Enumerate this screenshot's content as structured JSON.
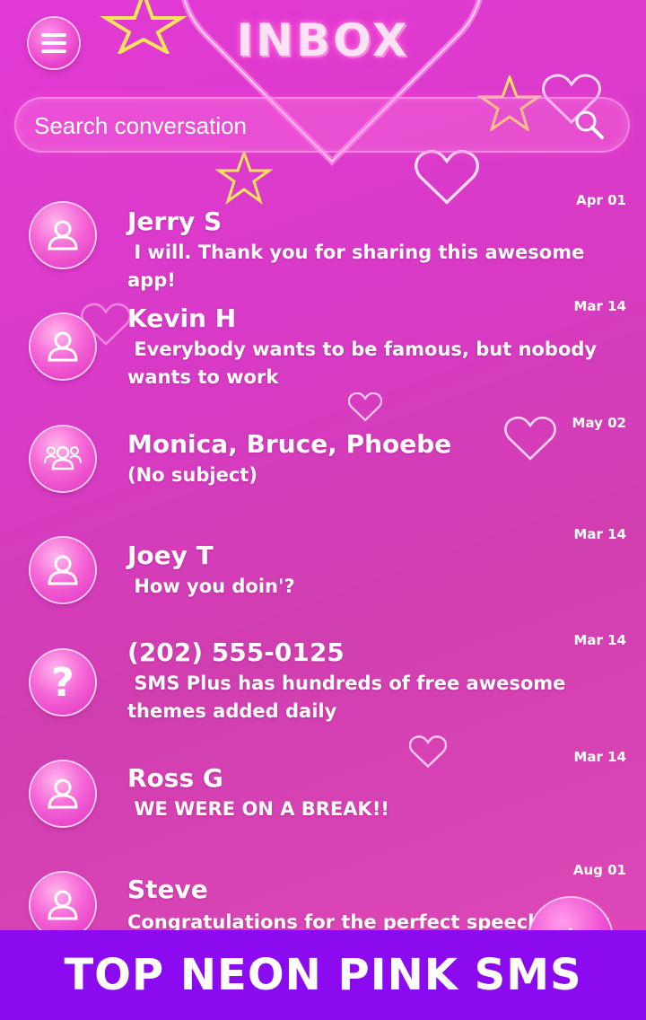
{
  "header": {
    "title": "INBOX",
    "menu_icon": "hamburger-icon"
  },
  "search": {
    "placeholder": "Search conversation",
    "icon": "search-icon"
  },
  "conversations": [
    {
      "name": "Jerry S",
      "snippet": " I will. Thank you for sharing this awesome app!",
      "date": "Apr 01",
      "avatar": "person-icon"
    },
    {
      "name": "Kevin H",
      "snippet": " Everybody wants to be famous, but nobody wants to work",
      "date": "Mar 14",
      "avatar": "person-icon"
    },
    {
      "name": "Monica, Bruce, Phoebe",
      "snippet": "(No subject)",
      "date": "May 02",
      "avatar": "group-icon"
    },
    {
      "name": "Joey T",
      "snippet": " How you doin'?",
      "date": "Mar 14",
      "avatar": "person-icon"
    },
    {
      "name": "(202) 555-0125",
      "snippet": " SMS Plus has hundreds of free awesome themes added daily",
      "date": "Mar 14",
      "avatar": "question-icon"
    },
    {
      "name": "Ross G",
      "snippet": " WE WERE ON A BREAK!!",
      "date": "Mar 14",
      "avatar": "person-icon"
    },
    {
      "name": "Steve",
      "snippet": "Congratulations for the perfect speech held t",
      "date": "Aug 01",
      "avatar": "person-icon"
    }
  ],
  "banner": {
    "text": "TOP NEON PINK SMS"
  },
  "colors": {
    "banner": "#8c0af0",
    "background": "#d83ac6",
    "accent": "#f04fd3"
  }
}
